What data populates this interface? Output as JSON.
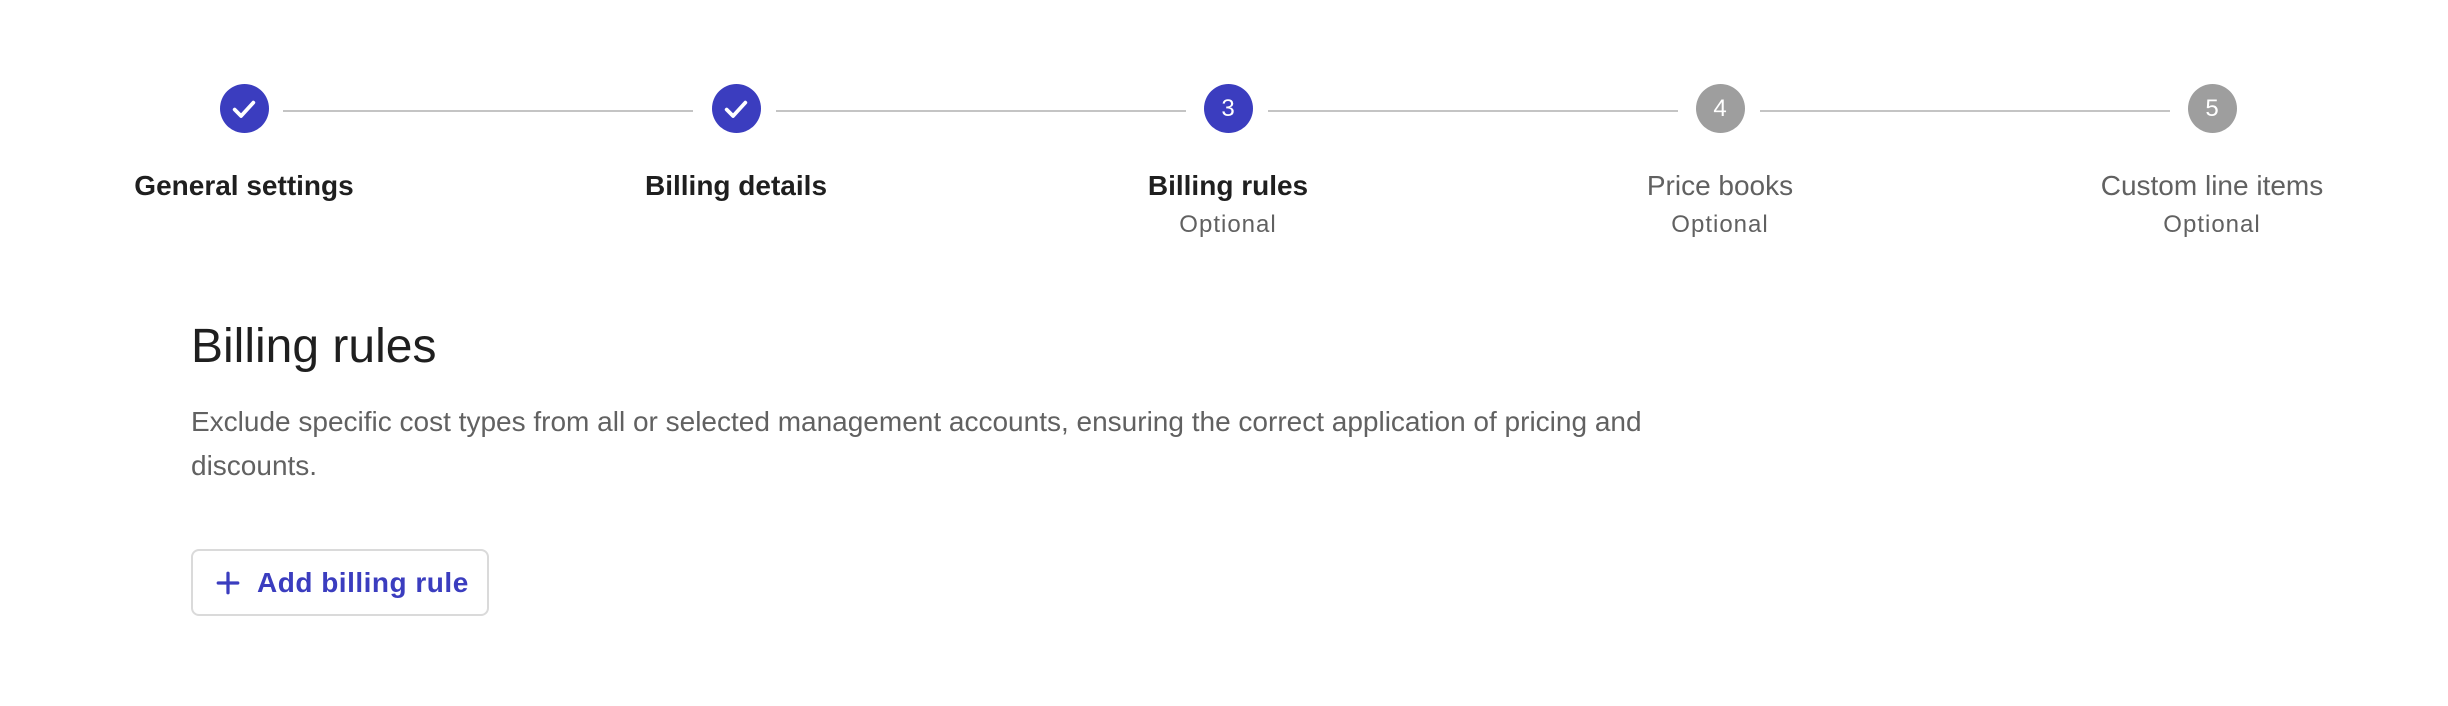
{
  "stepper": {
    "steps": [
      {
        "number": "1",
        "label": "General settings",
        "sublabel": "",
        "state": "done"
      },
      {
        "number": "2",
        "label": "Billing details",
        "sublabel": "",
        "state": "done"
      },
      {
        "number": "3",
        "label": "Billing rules",
        "sublabel": "Optional",
        "state": "active"
      },
      {
        "number": "4",
        "label": "Price books",
        "sublabel": "Optional",
        "state": "upcoming"
      },
      {
        "number": "5",
        "label": "Custom line items",
        "sublabel": "Optional",
        "state": "upcoming"
      }
    ]
  },
  "main": {
    "title": "Billing rules",
    "description": "Exclude specific cost types from all or selected management accounts, ensuring the correct application of pricing and discounts.",
    "add_button_label": "Add billing rule"
  },
  "icons": {
    "step_done": "check-icon",
    "add_button": "plus-icon"
  },
  "colors": {
    "accent": "#3b3dbf",
    "upcoming": "#9e9e9e",
    "connector": "#c4c4c4",
    "text_primary": "#1f1f1f",
    "text_secondary": "#616161"
  }
}
